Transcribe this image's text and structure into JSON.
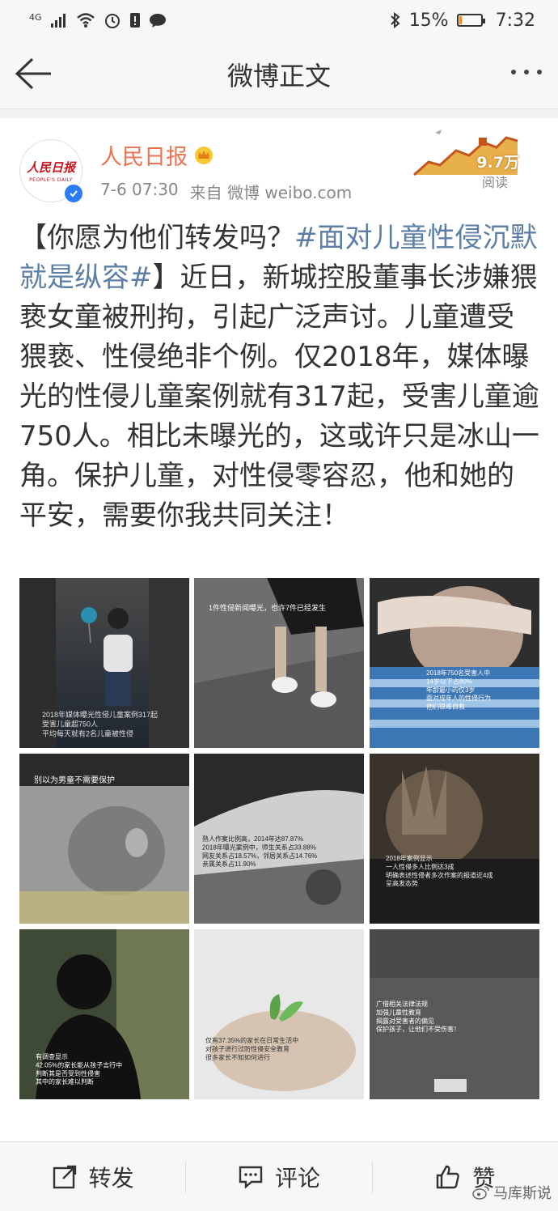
{
  "status_bar": {
    "network": "4G",
    "battery_percent": "15%",
    "battery_level": 0.15,
    "time": "7:32"
  },
  "nav": {
    "title": "微博正文"
  },
  "post": {
    "author": "人民日报",
    "avatar_text": "人民日报",
    "avatar_subtext": "PEOPLE'S DAILY",
    "timestamp": "7-6 07:30",
    "source": "来自 微博 weibo.com",
    "reads_count": "9.7万",
    "reads_label": "阅读",
    "text_part1": "【你愿为他们转发吗？",
    "hashtag": "#面对儿童性侵沉默就是纵容#",
    "text_part2": "】近日，新城控股董事长涉嫌猥亵女童被刑拘，引起广泛声讨。儿童遭受猥亵、性侵绝非个例。仅2018年，媒体曝光的性侵儿童案例就有317起，受害儿童逾750人。相比未曝光的，这或许只是冰山一角。保护儿童，对性侵零容忍，他和她的平安，需要你我共同关注！"
  },
  "images": [
    {
      "caption": "2018年媒体曝光性侵儿童案例317起 受害儿童超750人 平均每天就有2名儿童被性侵"
    },
    {
      "caption": "1件性侵新闻曝光，也许7件已经发生"
    },
    {
      "caption": "2018年750名受害人中 14岁以下占80% 年龄最小的仅3岁 面对成年人的性侵行为 他们很难自救"
    },
    {
      "caption": "别以为男童不需要保护"
    },
    {
      "caption": "熟人作案比例高，2014年达87.87% 2018年曝光案例中，师生关系占33.88% 网友关系占18.57%，邻居关系占14.76% 亲属关系占11.90%"
    },
    {
      "caption": "2018年案例显示 一人性侵多人比例达3成 明确表述性侵者多次作案的报道近4成 呈高发态势"
    },
    {
      "caption": "有调查显示 42.05%的家长能从孩子言行中 判断其是否受到性侵害 其中的家长难以判断"
    },
    {
      "caption": "仅有37.35%的家长在日常生活中 对孩子进行过防性侵安全教育 很多家长不知如何进行"
    },
    {
      "caption": "广借相关法律法规 加强儿童性教育 揭露对受害者的偏见 保护孩子，让他们不受伤害！"
    }
  ],
  "actions": {
    "repost": "转发",
    "comment": "评论",
    "like": "赞"
  },
  "watermark": "马库斯说"
}
